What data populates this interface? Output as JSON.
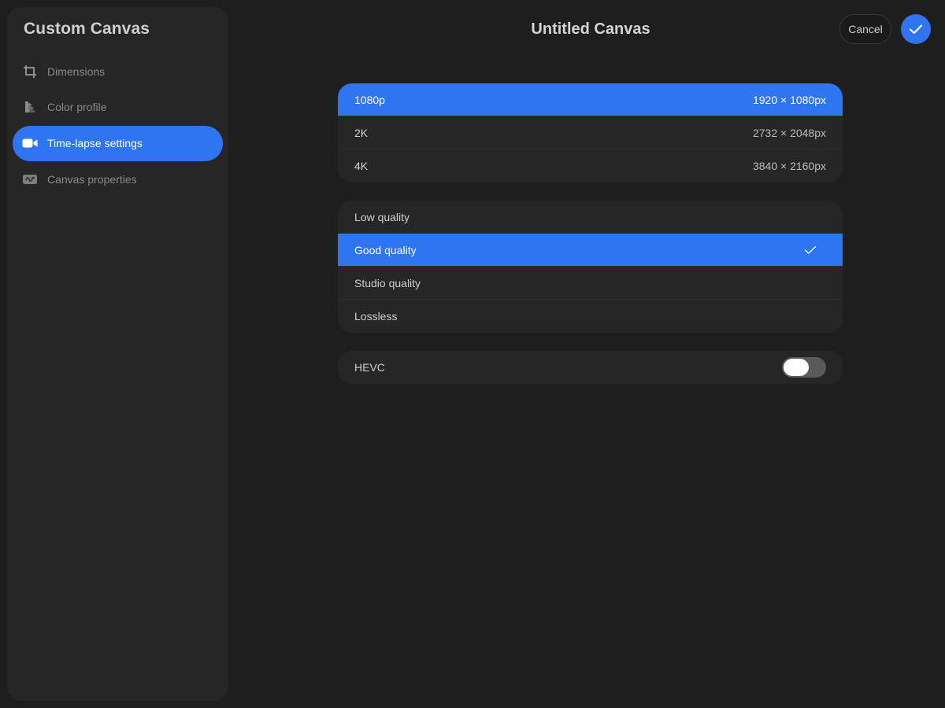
{
  "sidebar": {
    "title": "Custom Canvas",
    "items": [
      {
        "label": "Dimensions",
        "icon": "crop-icon",
        "active": false
      },
      {
        "label": "Color profile",
        "icon": "color-swatches-icon",
        "active": false
      },
      {
        "label": "Time-lapse settings",
        "icon": "video-camera-icon",
        "active": true
      },
      {
        "label": "Canvas properties",
        "icon": "canvas-properties-icon",
        "active": false
      }
    ]
  },
  "header": {
    "title": "Untitled Canvas",
    "cancel_label": "Cancel",
    "confirm_icon": "checkmark-icon"
  },
  "resolutions": [
    {
      "label": "1080p",
      "value": "1920 × 1080px",
      "selected": true
    },
    {
      "label": "2K",
      "value": "2732 × 2048px",
      "selected": false
    },
    {
      "label": "4K",
      "value": "3840 × 2160px",
      "selected": false
    }
  ],
  "qualities": [
    {
      "label": "Low quality",
      "selected": false
    },
    {
      "label": "Good quality",
      "selected": true
    },
    {
      "label": "Studio quality",
      "selected": false
    },
    {
      "label": "Lossless",
      "selected": false
    }
  ],
  "hevc": {
    "label": "HEVC",
    "enabled": false
  },
  "colors": {
    "accent": "#2f74f0",
    "background": "#1e1e1e",
    "panel": "#262626"
  }
}
